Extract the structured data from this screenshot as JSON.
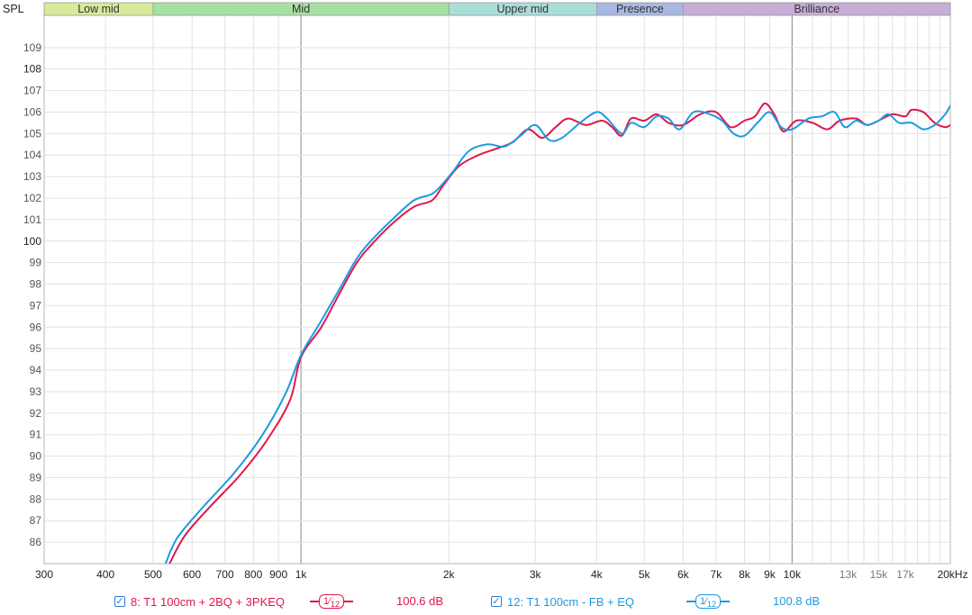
{
  "chart_data": {
    "type": "line",
    "ylabel": "SPL",
    "ylim": [
      85,
      110.5
    ],
    "xlim": [
      300,
      21000
    ],
    "x_scale": "log",
    "grid": true,
    "y_ticks": [
      86,
      87,
      88,
      89,
      90,
      91,
      92,
      93,
      94,
      95,
      96,
      97,
      98,
      99,
      100,
      101,
      102,
      103,
      104,
      105,
      106,
      107,
      108,
      109
    ],
    "x_ticks": [
      {
        "v": 300,
        "label": "300"
      },
      {
        "v": 400,
        "label": "400"
      },
      {
        "v": 500,
        "label": "500"
      },
      {
        "v": 600,
        "label": "600"
      },
      {
        "v": 700,
        "label": "700"
      },
      {
        "v": 800,
        "label": "800"
      },
      {
        "v": 900,
        "label": "900"
      },
      {
        "v": 1000,
        "label": "1k"
      },
      {
        "v": 2000,
        "label": "2k"
      },
      {
        "v": 3000,
        "label": "3k"
      },
      {
        "v": 4000,
        "label": "4k"
      },
      {
        "v": 5000,
        "label": "5k"
      },
      {
        "v": 6000,
        "label": "6k"
      },
      {
        "v": 7000,
        "label": "7k"
      },
      {
        "v": 8000,
        "label": "8k"
      },
      {
        "v": 9000,
        "label": "9k"
      },
      {
        "v": 10000,
        "label": "10k"
      },
      {
        "v": 13000,
        "label": "13k"
      },
      {
        "v": 15000,
        "label": "15k"
      },
      {
        "v": 17000,
        "label": "17k"
      },
      {
        "v": 20000,
        "label": "20kHz"
      }
    ],
    "bands": [
      {
        "name": "Low mid",
        "from": 300,
        "to": 500,
        "color": "#d6ea9a"
      },
      {
        "name": "Mid",
        "from": 500,
        "to": 2000,
        "color": "#a7e0a4"
      },
      {
        "name": "Upper mid",
        "from": 2000,
        "to": 4000,
        "color": "#a9ded9"
      },
      {
        "name": "Presence",
        "from": 4000,
        "to": 6000,
        "color": "#a9b8e2"
      },
      {
        "name": "Brilliance",
        "from": 6000,
        "to": 21000,
        "color": "#c7aed6"
      }
    ],
    "series": [
      {
        "name": "8: T1 100cm + 2BQ + 3PKEQ",
        "color": "#e0174a",
        "points": [
          [
            540,
            85
          ],
          [
            580,
            86.3
          ],
          [
            650,
            87.6
          ],
          [
            750,
            89.1
          ],
          [
            850,
            90.7
          ],
          [
            950,
            92.6
          ],
          [
            1000,
            94.6
          ],
          [
            1100,
            96.0
          ],
          [
            1200,
            97.6
          ],
          [
            1300,
            99.0
          ],
          [
            1400,
            99.9
          ],
          [
            1550,
            100.9
          ],
          [
            1700,
            101.6
          ],
          [
            1850,
            101.9
          ],
          [
            1950,
            102.6
          ],
          [
            2100,
            103.5
          ],
          [
            2300,
            104.0
          ],
          [
            2500,
            104.3
          ],
          [
            2700,
            104.6
          ],
          [
            2900,
            105.2
          ],
          [
            3100,
            104.8
          ],
          [
            3300,
            105.3
          ],
          [
            3500,
            105.7
          ],
          [
            3800,
            105.4
          ],
          [
            4100,
            105.6
          ],
          [
            4300,
            105.3
          ],
          [
            4500,
            104.9
          ],
          [
            4700,
            105.7
          ],
          [
            5000,
            105.6
          ],
          [
            5300,
            105.9
          ],
          [
            5600,
            105.5
          ],
          [
            6000,
            105.4
          ],
          [
            6500,
            105.9
          ],
          [
            7000,
            106.0
          ],
          [
            7500,
            105.3
          ],
          [
            8000,
            105.6
          ],
          [
            8400,
            105.8
          ],
          [
            8800,
            106.4
          ],
          [
            9200,
            105.9
          ],
          [
            9600,
            105.1
          ],
          [
            10200,
            105.6
          ],
          [
            11000,
            105.5
          ],
          [
            11800,
            105.2
          ],
          [
            12500,
            105.6
          ],
          [
            13500,
            105.7
          ],
          [
            14200,
            105.4
          ],
          [
            15000,
            105.6
          ],
          [
            16000,
            105.9
          ],
          [
            17000,
            105.8
          ],
          [
            17500,
            106.1
          ],
          [
            18500,
            106.0
          ],
          [
            19500,
            105.5
          ],
          [
            20500,
            105.3
          ],
          [
            21000,
            105.4
          ]
        ]
      },
      {
        "name": "12: T1 100cm - FB + EQ",
        "color": "#1e9ae0",
        "points": [
          [
            530,
            85
          ],
          [
            560,
            86.2
          ],
          [
            630,
            87.6
          ],
          [
            730,
            89.2
          ],
          [
            830,
            90.9
          ],
          [
            930,
            92.9
          ],
          [
            1000,
            94.7
          ],
          [
            1100,
            96.3
          ],
          [
            1200,
            97.8
          ],
          [
            1300,
            99.2
          ],
          [
            1400,
            100.1
          ],
          [
            1550,
            101.1
          ],
          [
            1700,
            101.9
          ],
          [
            1850,
            102.2
          ],
          [
            1950,
            102.7
          ],
          [
            2050,
            103.3
          ],
          [
            2200,
            104.2
          ],
          [
            2400,
            104.5
          ],
          [
            2600,
            104.4
          ],
          [
            2800,
            104.9
          ],
          [
            3000,
            105.4
          ],
          [
            3200,
            104.7
          ],
          [
            3400,
            104.8
          ],
          [
            3700,
            105.5
          ],
          [
            4000,
            106.0
          ],
          [
            4200,
            105.7
          ],
          [
            4500,
            105.0
          ],
          [
            4700,
            105.5
          ],
          [
            5000,
            105.3
          ],
          [
            5300,
            105.8
          ],
          [
            5600,
            105.7
          ],
          [
            5900,
            105.2
          ],
          [
            6300,
            106.0
          ],
          [
            6800,
            105.9
          ],
          [
            7200,
            105.6
          ],
          [
            7600,
            105.0
          ],
          [
            8000,
            104.9
          ],
          [
            8500,
            105.5
          ],
          [
            9000,
            106.0
          ],
          [
            9500,
            105.3
          ],
          [
            10000,
            105.2
          ],
          [
            10800,
            105.7
          ],
          [
            11500,
            105.8
          ],
          [
            12200,
            106.0
          ],
          [
            12800,
            105.3
          ],
          [
            13500,
            105.6
          ],
          [
            14200,
            105.4
          ],
          [
            15000,
            105.6
          ],
          [
            15700,
            105.9
          ],
          [
            16500,
            105.5
          ],
          [
            17500,
            105.5
          ],
          [
            18500,
            105.2
          ],
          [
            19500,
            105.4
          ],
          [
            20500,
            105.9
          ],
          [
            21000,
            106.3
          ]
        ]
      }
    ]
  },
  "legend": {
    "items": [
      {
        "label": "8: T1 100cm + 2BQ + 3PKEQ",
        "color": "#e0174a",
        "smoothing_num": "1",
        "smoothing_den": "12",
        "level": "100.6 dB"
      },
      {
        "label": "12: T1 100cm - FB + EQ",
        "color": "#1e9ae0",
        "smoothing_num": "1",
        "smoothing_den": "12",
        "level": "100.8 dB"
      }
    ],
    "check": "✓"
  }
}
